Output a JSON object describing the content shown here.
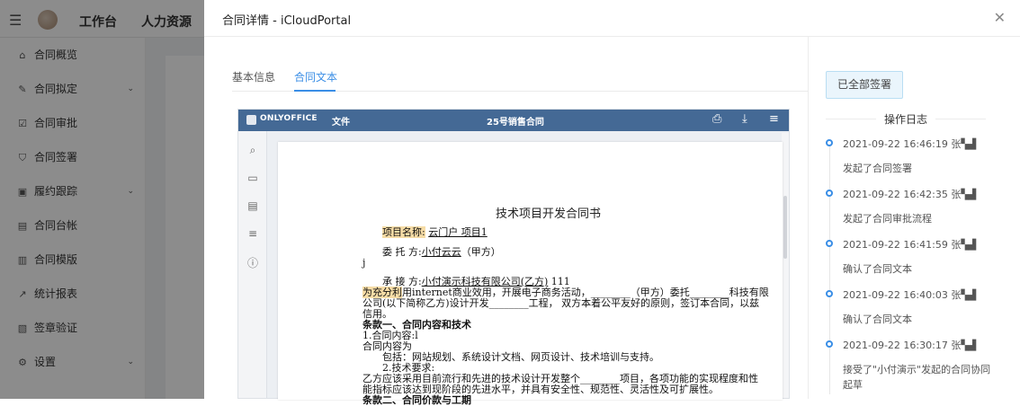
{
  "app": {
    "nav": [
      "工作台",
      "人力资源"
    ]
  },
  "sidebar": {
    "items": [
      {
        "label": "合同概览",
        "icon": "home-icon",
        "glyph": "⌂",
        "chevron": false
      },
      {
        "label": "合同拟定",
        "icon": "edit-icon",
        "glyph": "✎",
        "chevron": true
      },
      {
        "label": "合同审批",
        "icon": "check-square-icon",
        "glyph": "☑",
        "chevron": false
      },
      {
        "label": "合同签署",
        "icon": "shield-check-icon",
        "glyph": "⛉",
        "chevron": false
      },
      {
        "label": "履约跟踪",
        "icon": "briefcase-icon",
        "glyph": "▣",
        "chevron": true
      },
      {
        "label": "合同台帐",
        "icon": "ledger-icon",
        "glyph": "▤",
        "chevron": false
      },
      {
        "label": "合同模版",
        "icon": "template-icon",
        "glyph": "▥",
        "chevron": false
      },
      {
        "label": "统计报表",
        "icon": "line-chart-icon",
        "glyph": "↗",
        "chevron": false
      },
      {
        "label": "签章验证",
        "icon": "stamp-icon",
        "glyph": "▧",
        "chevron": false
      },
      {
        "label": "设置",
        "icon": "gear-icon",
        "glyph": "⚙",
        "chevron": true
      }
    ]
  },
  "drawer": {
    "title": "合同详情 - iCloudPortal",
    "close_glyph": "✕",
    "tabs": [
      "基本信息",
      "合同文本"
    ],
    "active_tab": 1,
    "status_badge": "已全部签署",
    "log_title": "操作日志",
    "log": [
      {
        "time": "2021-09-22 16:46:19",
        "who": "张▚▟",
        "desc": "发起了合同签署"
      },
      {
        "time": "2021-09-22 16:42:35",
        "who": "张▚▟",
        "desc": "发起了合同审批流程"
      },
      {
        "time": "2021-09-22 16:41:59",
        "who": "张▚▟",
        "desc": "确认了合同文本"
      },
      {
        "time": "2021-09-22 16:40:03",
        "who": "张▚▟",
        "desc": "确认了合同文本"
      },
      {
        "time": "2021-09-22 16:30:17",
        "who": "张▚▟",
        "desc": "接受了\"小付演示\"发起的合同协同起草"
      }
    ]
  },
  "editor": {
    "brand": "ONLYOFFICE",
    "file_menu": "文件",
    "doc_name": "25号销售合同",
    "rail_icons": [
      {
        "name": "search-icon",
        "glyph": "⌕"
      },
      {
        "name": "comment-icon",
        "glyph": "▭"
      },
      {
        "name": "chat-icon",
        "glyph": "▤"
      },
      {
        "name": "align-icon",
        "glyph": "≡"
      },
      {
        "name": "info-icon",
        "glyph": "ⓘ"
      }
    ],
    "paper": {
      "title": "技术项目开发合同书",
      "project_label": "项目名称:",
      "project_value": "云门户 项目1",
      "party_a_label": "委 托 方:",
      "party_a_value": "小付云云",
      "party_a_suffix": "（甲方）",
      "j": "j",
      "party_b_label": "承 接 方:",
      "party_b_value": "小付演示科技有限公司(乙方)",
      "party_b_num": "111",
      "body_hl": "为充分利",
      "body1": "用internet商业效用，开展电子商务活动，________（甲方）委托________科技有限",
      "body2": "公司(以下简称乙方)设计开发________工程，  双方本着公平友好的原则，签订本合同，以兹",
      "body3": "信用。",
      "clause1": "条款一、合同内容和技术",
      "c1_1": "1.合同内容:l",
      "c1_2": "合同内容为",
      "c1_3": "包括：网站规划、系统设计文档、网页设计、技术培训与支持。",
      "c1_4": "2.技术要求:",
      "c1_5": "乙方应该采用目前流行和先进的技术设计开发整个________项目，各项功能的实现程度和性",
      "c1_6": "能指标应该达到现阶段的先进水平，并具有安全性、规范性、灵活性及可扩展性。",
      "clause2": "条款二、合同价款与工期",
      "c2_1": "1.合同价款:"
    }
  }
}
